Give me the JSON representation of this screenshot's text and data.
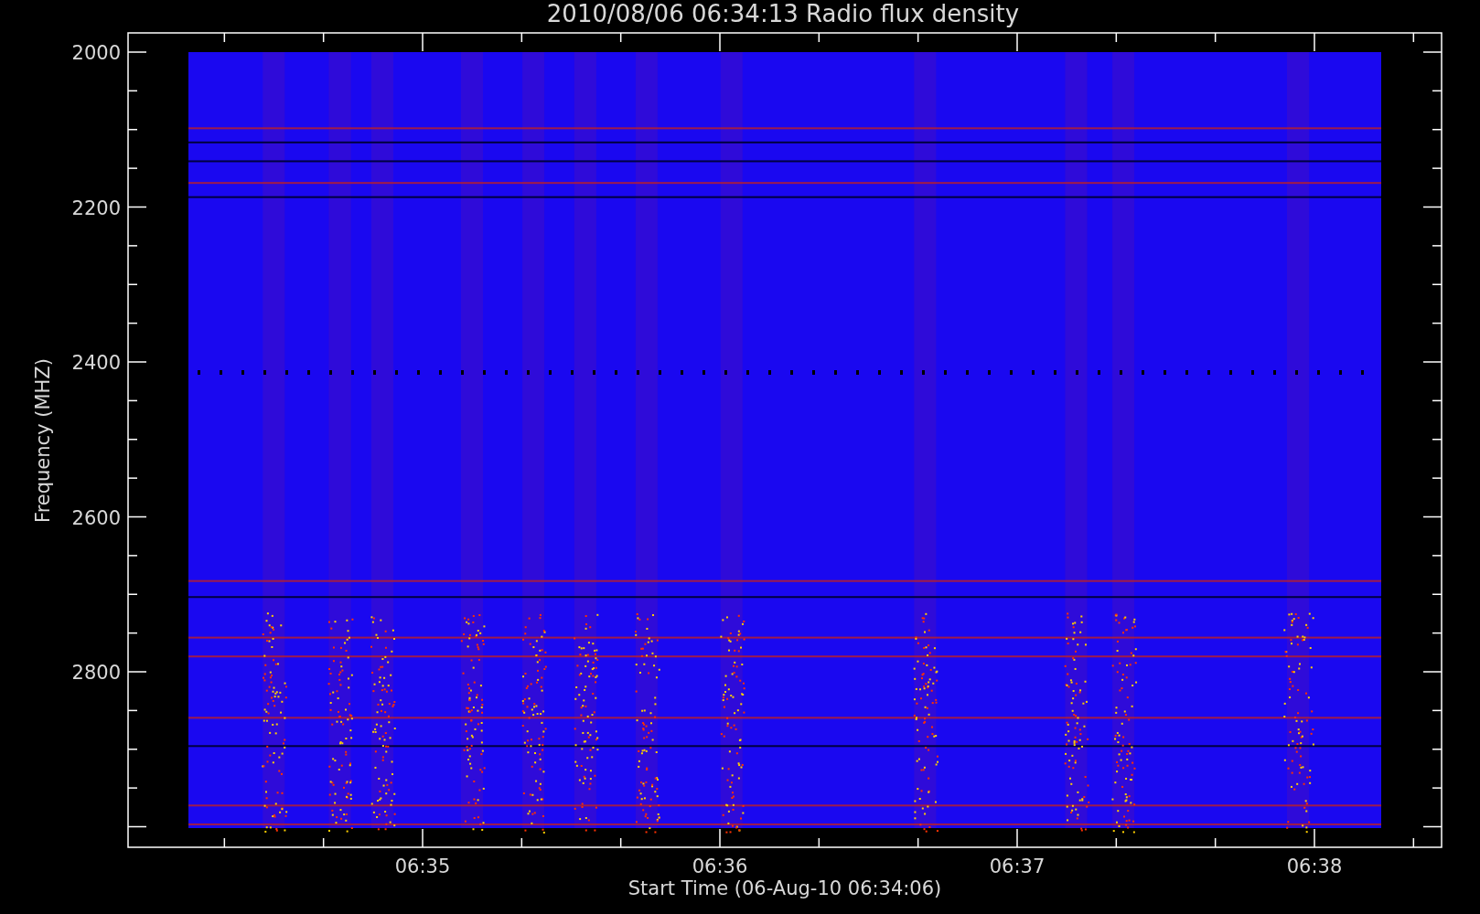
{
  "title": "2010/08/06 06:34:13 Radio flux density",
  "y_axis": {
    "label": "Frequency (MHZ)",
    "ticks": [
      "2000",
      "2200",
      "2400",
      "2600",
      "2800"
    ]
  },
  "x_axis": {
    "label": "Start Time (06-Aug-10 06:34:06)",
    "ticks": [
      "06:35",
      "06:36",
      "06:37",
      "06:38"
    ]
  }
}
